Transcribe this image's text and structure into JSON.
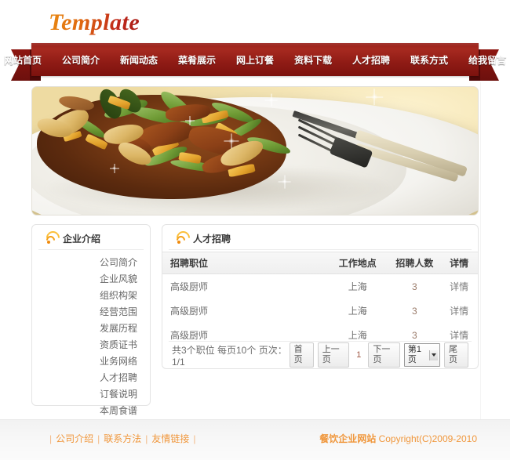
{
  "site": {
    "logo_text": "Template"
  },
  "nav": {
    "items": [
      {
        "label": "网站首页",
        "name": "nav-home"
      },
      {
        "label": "公司简介",
        "name": "nav-about"
      },
      {
        "label": "新闻动态",
        "name": "nav-news"
      },
      {
        "label": "菜肴展示",
        "name": "nav-dishes"
      },
      {
        "label": "网上订餐",
        "name": "nav-order"
      },
      {
        "label": "资料下载",
        "name": "nav-downloads"
      },
      {
        "label": "人才招聘",
        "name": "nav-jobs"
      },
      {
        "label": "联系方式",
        "name": "nav-contact"
      },
      {
        "label": "给我留言",
        "name": "nav-message"
      }
    ]
  },
  "banner": {
    "icon": "food-photo",
    "alt": "盘中菜肴图片"
  },
  "sidebar": {
    "icon": "rss-icon",
    "title": "企业介绍",
    "items": [
      {
        "label": "公司简介"
      },
      {
        "label": "企业风貌"
      },
      {
        "label": "组织构架"
      },
      {
        "label": "经营范围"
      },
      {
        "label": "发展历程"
      },
      {
        "label": "资质证书"
      },
      {
        "label": "业务网络"
      },
      {
        "label": "人才招聘"
      },
      {
        "label": "订餐说明"
      },
      {
        "label": "本周食谱"
      }
    ]
  },
  "main": {
    "icon": "rss-icon",
    "title": "人才招聘",
    "table": {
      "headers": [
        "招聘职位",
        "工作地点",
        "招聘人数",
        "详情"
      ],
      "rows": [
        {
          "position": "高级厨师",
          "location": "上海",
          "count": "3",
          "detail": "详情"
        },
        {
          "position": "高级厨师",
          "location": "上海",
          "count": "3",
          "detail": "详情"
        },
        {
          "position": "高级厨师",
          "location": "上海",
          "count": "3",
          "detail": "详情"
        }
      ]
    },
    "pager": {
      "info": "共3个职位 每页10个 页次：1/1",
      "first": "首页",
      "prev": "上一页",
      "current": "1",
      "next": "下一页",
      "select_value": "第1页",
      "last": "尾页"
    }
  },
  "footer": {
    "sep": "|",
    "links": [
      {
        "label": "公司介绍"
      },
      {
        "label": "联系方法"
      },
      {
        "label": "友情链接"
      }
    ],
    "copyright_cn": "餐饮企业网站",
    "copyright_en": "Copyright(C)2009-2010"
  },
  "colors": {
    "nav_red": "#a72a20",
    "nav_red_dark": "#7c120e",
    "accent_orange": "#f0973c",
    "logo_orange": "#e98a12",
    "logo_red": "#a81c16"
  }
}
